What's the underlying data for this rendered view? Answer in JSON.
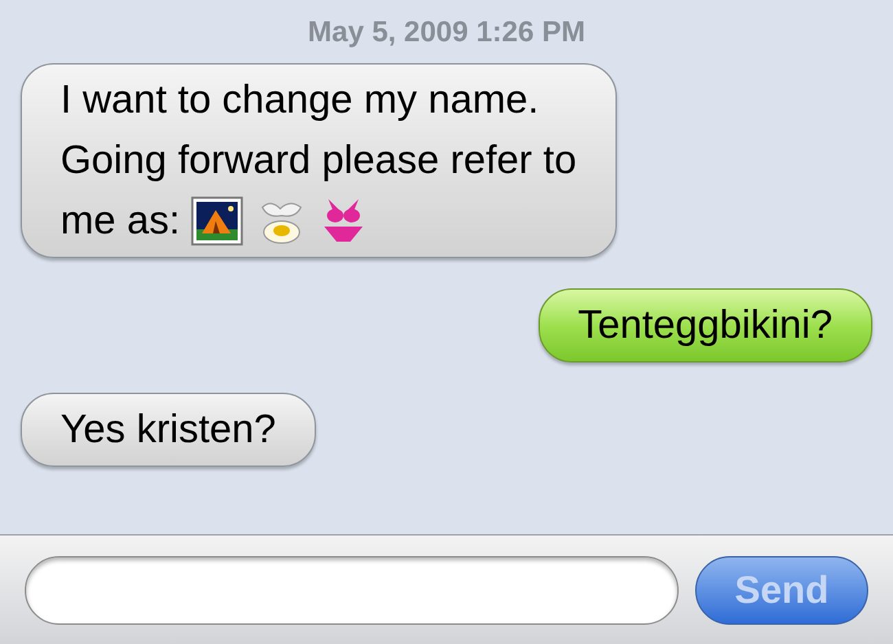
{
  "timestamp": "May 5, 2009 1:26 PM",
  "messages": [
    {
      "kind": "received",
      "lines": [
        "I want to change my name.",
        "Going forward please refer to",
        "me as:"
      ],
      "emoji": [
        {
          "kind": "tent"
        },
        {
          "kind": "egg"
        },
        {
          "kind": "bikini"
        }
      ]
    },
    {
      "kind": "sent",
      "lines": [
        "Tenteggbikini?"
      ]
    },
    {
      "kind": "received",
      "lines": [
        "Yes kristen?"
      ]
    }
  ],
  "composer": {
    "send_label": "Send"
  }
}
